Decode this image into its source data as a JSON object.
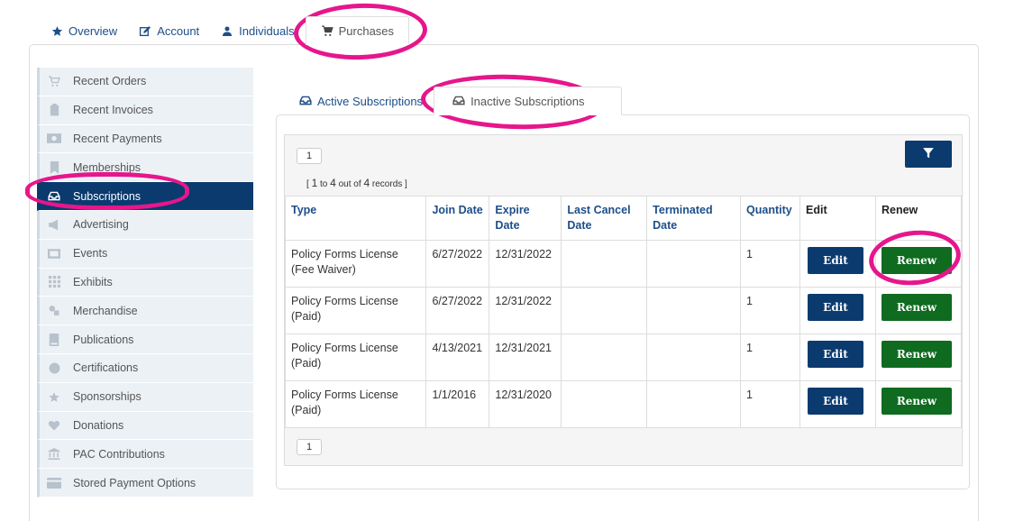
{
  "top_tabs": [
    {
      "label": "Overview",
      "icon": "star-icon"
    },
    {
      "label": "Account",
      "icon": "edit-icon"
    },
    {
      "label": "Individuals",
      "icon": "user-icon"
    },
    {
      "label": "Purchases",
      "icon": "cart-icon",
      "active": true
    }
  ],
  "sidebar": {
    "items": [
      {
        "label": "Recent Orders",
        "icon": "cart-icon"
      },
      {
        "label": "Recent Invoices",
        "icon": "clipboard-icon"
      },
      {
        "label": "Recent Payments",
        "icon": "money-icon"
      },
      {
        "label": "Memberships",
        "icon": "bookmark-icon"
      },
      {
        "label": "Subscriptions",
        "icon": "inbox-icon",
        "active": true
      },
      {
        "label": "Advertising",
        "icon": "megaphone-icon"
      },
      {
        "label": "Events",
        "icon": "ticket-icon"
      },
      {
        "label": "Exhibits",
        "icon": "grid-icon"
      },
      {
        "label": "Merchandise",
        "icon": "shapes-icon"
      },
      {
        "label": "Publications",
        "icon": "book-icon"
      },
      {
        "label": "Certifications",
        "icon": "circle-icon"
      },
      {
        "label": "Sponsorships",
        "icon": "star-icon"
      },
      {
        "label": "Donations",
        "icon": "heart-icon"
      },
      {
        "label": "PAC Contributions",
        "icon": "bank-icon"
      },
      {
        "label": "Stored Payment Options",
        "icon": "credit-card-icon"
      }
    ]
  },
  "inner_tabs": [
    {
      "label": "Active Subscriptions",
      "icon": "inbox-icon"
    },
    {
      "label": "Inactive Subscriptions",
      "icon": "inbox-icon",
      "active": true
    }
  ],
  "grid": {
    "page_top": "1",
    "page_bottom": "1",
    "records": {
      "open": "[",
      "a": "1",
      "to": "to",
      "b": "4",
      "outof": "out of",
      "total": "4",
      "word": "records",
      "close": "]"
    },
    "headers": [
      "Type",
      "Join Date",
      "Expire Date",
      "Last Cancel Date",
      "Terminated Date",
      "Quantity",
      "Edit",
      "Renew"
    ],
    "rows": [
      {
        "type": "Policy Forms License (Fee Waiver)",
        "join": "6/27/2022",
        "expire": "12/31/2022",
        "cancel": "",
        "terminated": "",
        "qty": "1",
        "edit": "Edit",
        "renew": "Renew"
      },
      {
        "type": "Policy Forms License (Paid)",
        "join": "6/27/2022",
        "expire": "12/31/2022",
        "cancel": "",
        "terminated": "",
        "qty": "1",
        "edit": "Edit",
        "renew": "Renew"
      },
      {
        "type": "Policy Forms License (Paid)",
        "join": "4/13/2021",
        "expire": "12/31/2021",
        "cancel": "",
        "terminated": "",
        "qty": "1",
        "edit": "Edit",
        "renew": "Renew"
      },
      {
        "type": "Policy Forms License (Paid)",
        "join": "1/1/2016",
        "expire": "12/31/2020",
        "cancel": "",
        "terminated": "",
        "qty": "1",
        "edit": "Edit",
        "renew": "Renew"
      }
    ]
  },
  "colors": {
    "primary": "#0b3a6e",
    "renew": "#0e6b1f",
    "link": "#1d4e89",
    "highlight": "#e6168c"
  }
}
